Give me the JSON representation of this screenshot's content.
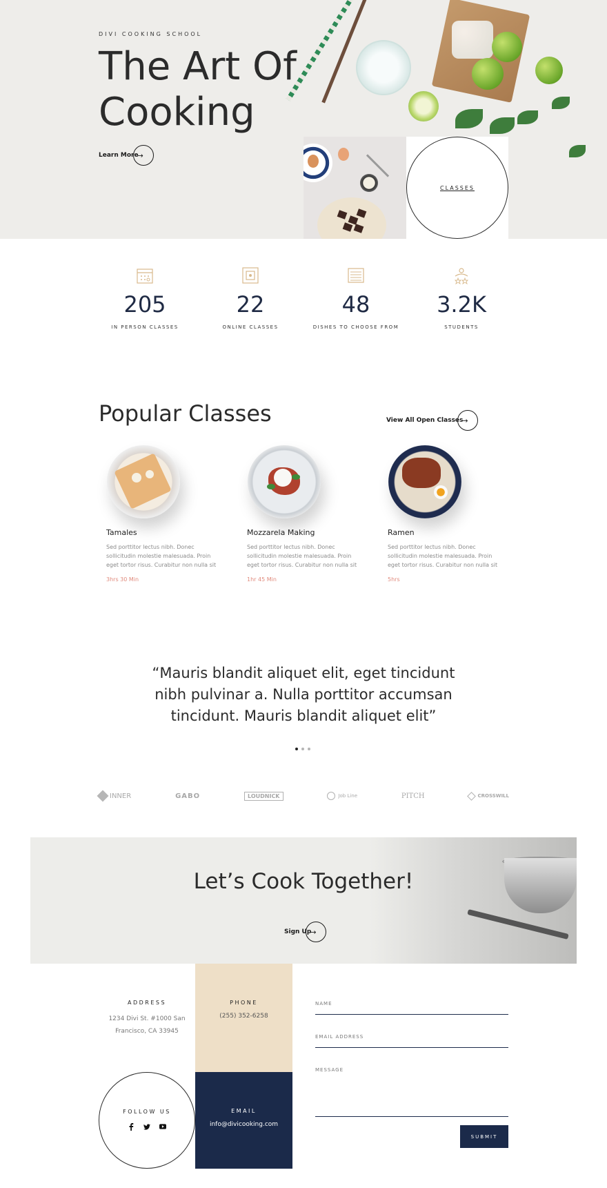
{
  "hero": {
    "eyebrow": "DIVI COOKING SCHOOL",
    "title": "The Art Of Cooking",
    "cta_label": "Learn More",
    "cta_arrow": "→",
    "classes_label": "CLASSES"
  },
  "stats": [
    {
      "icon": "calendar-icon",
      "value": "205",
      "label": "IN PERSON CLASSES"
    },
    {
      "icon": "screen-icon",
      "value": "22",
      "label": "ONLINE CLASSES"
    },
    {
      "icon": "list-icon",
      "value": "48",
      "label": "DISHES TO CHOOSE FROM"
    },
    {
      "icon": "students-icon",
      "value": "3.2K",
      "label": "STUDENTS"
    }
  ],
  "popular": {
    "title": "Popular Classes",
    "view_all_label": "View All Open Classes",
    "view_all_arrow": "→",
    "courses": [
      {
        "name": "Tamales",
        "description": "Sed porttitor lectus nibh. Donec sollicitudin molestie malesuada. Proin eget tortor risus. Curabitur non nulla sit",
        "duration": "3hrs 30 Min"
      },
      {
        "name": "Mozzarela Making",
        "description": "Sed porttitor lectus nibh. Donec sollicitudin molestie malesuada. Proin eget tortor risus. Curabitur non nulla sit",
        "duration": "1hr 45 Min"
      },
      {
        "name": "Ramen",
        "description": "Sed porttitor lectus nibh. Donec sollicitudin molestie malesuada. Proin eget tortor risus. Curabitur non nulla sit",
        "duration": "5hrs"
      }
    ]
  },
  "testimonial": {
    "quote": "“Mauris blandit aliquet elit, eget tincidunt nibh pulvinar a. Nulla porttitor accumsan tincidunt. Mauris blandit aliquet elit”",
    "dots_count": 3,
    "active_dot": 1
  },
  "logos": [
    "INNER",
    "GABO",
    "LOUDNICK",
    "Job Line",
    "PITCH",
    "CROSSWILL"
  ],
  "cta": {
    "title": "Let’s Cook Together!",
    "button_label": "Sign Up",
    "button_arrow": "→"
  },
  "contact": {
    "address_heading": "ADDRESS",
    "address_text": "1234 Divi St. #1000 San Francisco, CA 33945",
    "phone_heading": "PHONE",
    "phone_text": "(255) 352-6258",
    "follow_heading": "FOLLOW US",
    "social_icons": [
      "facebook-icon",
      "twitter-icon",
      "youtube-icon"
    ],
    "email_heading": "EMAIL",
    "email_text": "info@divicooking.com"
  },
  "form": {
    "name_label": "NAME",
    "email_label": "EMAIL ADDRESS",
    "message_label": "MESSAGE",
    "submit_label": "SUBMIT"
  },
  "colors": {
    "navy": "#1b2a4a",
    "beige": "#eedfc7",
    "accent_duration": "#e08a7c",
    "hero_bg": "#eeedea",
    "stat_icon": "#d8b98c"
  }
}
